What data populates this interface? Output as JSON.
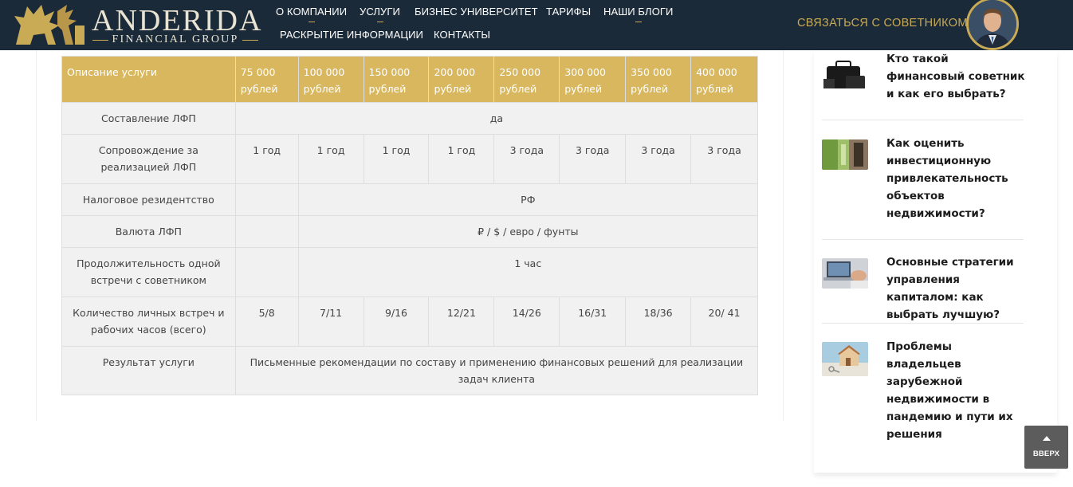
{
  "header": {
    "logo": {
      "name": "ANDERIDA",
      "subtitle": "FINANCIAL GROUP"
    },
    "nav": [
      {
        "label": "О КОМПАНИИ"
      },
      {
        "label": "УСЛУГИ"
      },
      {
        "label": "БИЗНЕС УНИВЕРСИТЕТ"
      },
      {
        "label": "ТАРИФЫ"
      },
      {
        "label": "НАШИ БЛОГИ"
      },
      {
        "label": "РАСКРЫТИЕ ИНФОРМАЦИИ"
      },
      {
        "label": "КОНТАКТЫ"
      }
    ],
    "contact_button": "СВЯЗАТЬСЯ С СОВЕТНИКОМ",
    "colors": {
      "header_bg": "#1b2a38",
      "accent_gold": "#c9aa55"
    }
  },
  "table": {
    "header_label": "Описание услуги",
    "tiers": [
      "75 000 рублей",
      "100 000 рублей",
      "150 000 рублей",
      "200 000 рублей",
      "250 000 рублей",
      "300 000 рублей",
      "350 000 рублей",
      "400 000 рублей"
    ],
    "rows": [
      {
        "label": "Составление ЛФП",
        "value": "да"
      },
      {
        "label": "Сопровождение за реализацией ЛФП",
        "values": [
          "1 год",
          "1 год",
          "1 год",
          "1 год",
          "3 года",
          "3 года",
          "3 года",
          "3 года"
        ]
      },
      {
        "label": "Налоговое резидентство",
        "value": "РФ"
      },
      {
        "label": "Валюта ЛФП",
        "value": "₽ / $ / евро / фунты"
      },
      {
        "label": "Продолжительность одной встречи с советником",
        "value": "1 час"
      },
      {
        "label": "Количество личных встреч и рабочих часов (всего)",
        "values": [
          "5/8",
          "7/11",
          "9/16",
          "12/21",
          "14/26",
          "16/31",
          "18/36",
          "20/ 41"
        ]
      },
      {
        "label": "Результат услуги",
        "value": "Письменные рекомендации по составу и применению финансовых решений для реализации задач клиента"
      }
    ],
    "colors": {
      "header_bg": "#d8b75e",
      "cell_bg": "#f1f1f1"
    }
  },
  "sidebar": {
    "posts": [
      {
        "title": "Кто такой финансовый советник и как его выбрать?",
        "thumb": "briefcase-image"
      },
      {
        "title": "Как оценить инвестиционную привлекательность объектов недвижимости?",
        "thumb": "door-image"
      },
      {
        "title": "Основные стратегии управления капиталом: как выбрать лучшую?",
        "thumb": "laptop-image"
      },
      {
        "title": "Проблемы владельцев зарубежной недвижимости в пандемию и пути их решения",
        "thumb": "house-keys-image"
      }
    ]
  },
  "scroll_top": {
    "label": "ВВЕРХ"
  }
}
